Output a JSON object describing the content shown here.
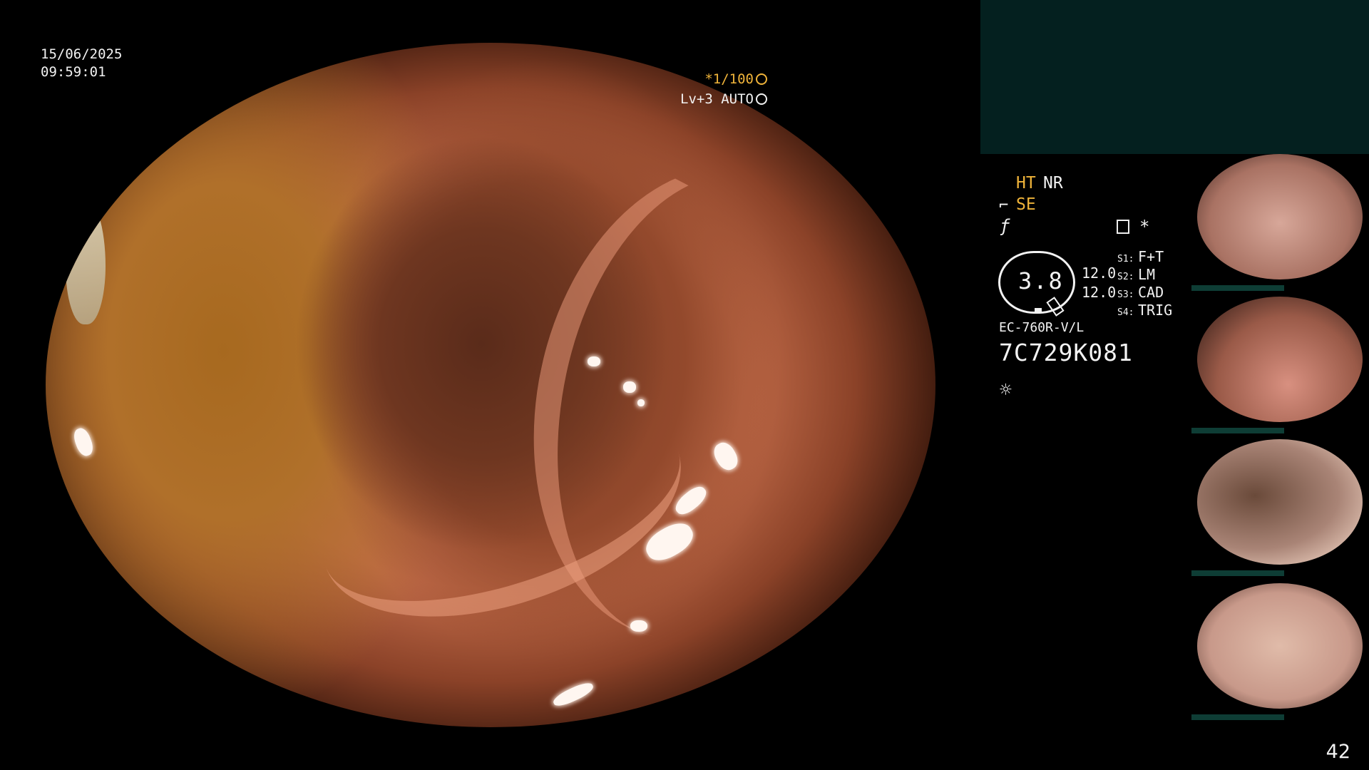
{
  "overlay": {
    "date": "15/06/2025",
    "time": "09:59:01",
    "shutter": "*1/100",
    "level": "Lv+3 AUTO"
  },
  "panel": {
    "ht": "HT",
    "nr": "NR",
    "se": "SE",
    "star": "*",
    "gauge_value": "3.8",
    "values": [
      "12.0",
      "12.0"
    ],
    "switches": [
      {
        "key": "S1:",
        "value": "F+T"
      },
      {
        "key": "S2:",
        "value": "LM"
      },
      {
        "key": "S3:",
        "value": "CAD"
      },
      {
        "key": "S4:",
        "value": "TRIG"
      }
    ],
    "model": "EC-760R-V/L",
    "serial": "7C729K081"
  },
  "page_number": "42",
  "colors": {
    "accent_amber": "#f0b43a",
    "top_panel": "#04201f",
    "thumb_bar": "#0e3d35"
  },
  "icons": [
    "shutter-icon",
    "auto-iris-icon",
    "se-mode-icon",
    "f-mode-icon",
    "memo-icon",
    "light-icon"
  ]
}
